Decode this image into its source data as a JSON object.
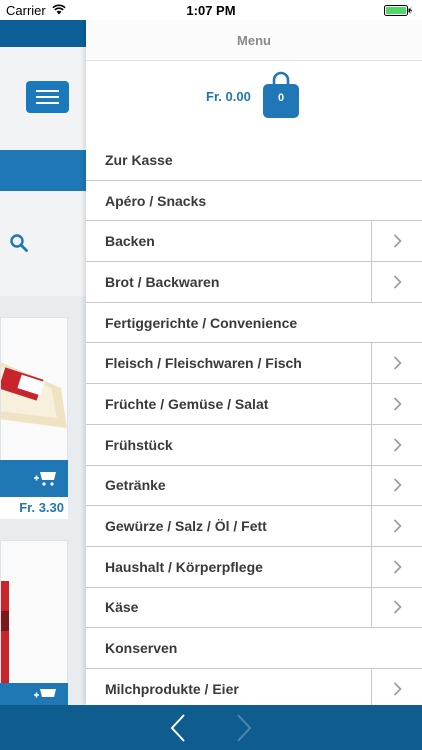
{
  "status_bar": {
    "carrier": "Carrier",
    "time": "1:07 PM"
  },
  "background_app": {
    "price_label": "Fr. 3.30"
  },
  "menu": {
    "title": "Menu",
    "cart": {
      "total": "Fr. 0.00",
      "count": "0"
    },
    "items": [
      {
        "label": "Zur Kasse",
        "has_submenu": false
      },
      {
        "label": "Apéro / Snacks",
        "has_submenu": false
      },
      {
        "label": "Backen",
        "has_submenu": true
      },
      {
        "label": "Brot / Backwaren",
        "has_submenu": true
      },
      {
        "label": "Fertiggerichte / Convenience",
        "has_submenu": false
      },
      {
        "label": "Fleisch / Fleischwaren / Fisch",
        "has_submenu": true
      },
      {
        "label": "Früchte / Gemüse / Salat",
        "has_submenu": true
      },
      {
        "label": "Frühstück",
        "has_submenu": true
      },
      {
        "label": "Getränke",
        "has_submenu": true
      },
      {
        "label": "Gewürze / Salz / Öl / Fett",
        "has_submenu": true
      },
      {
        "label": "Haushalt / Körperpflege",
        "has_submenu": true
      },
      {
        "label": "Käse",
        "has_submenu": true
      },
      {
        "label": "Konserven",
        "has_submenu": false
      },
      {
        "label": "Milchprodukte / Eier",
        "has_submenu": true
      }
    ]
  },
  "colors": {
    "accent_blue": "#1f77b6",
    "toolbar_blue": "#0f5c8f",
    "battery_green": "#4cd964"
  },
  "icons": {
    "menu_button": "hamburger-icon",
    "search": "search-icon",
    "cart": "shopping-bag-icon",
    "add_to_cart": "add-cart-icon",
    "submenu": "chevron-right-icon",
    "back": "chevron-left-icon",
    "forward": "chevron-right-icon"
  }
}
